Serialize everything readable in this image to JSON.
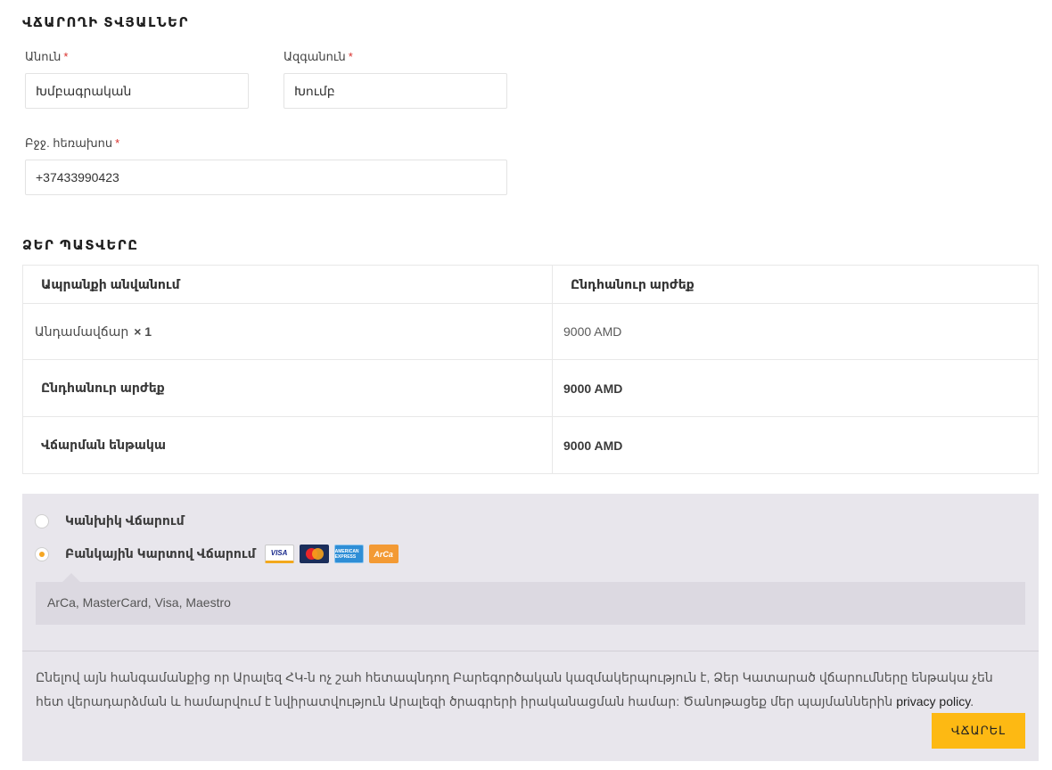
{
  "billing": {
    "title": "ՎՃԱՐՈՂԻ ՏՎՅԱԼՆԵՐ",
    "first_name": {
      "label": "Անուն",
      "required": "*",
      "value": "Խմբագրական"
    },
    "last_name": {
      "label": "Ազգանուն",
      "required": "*",
      "value": "Խումբ"
    },
    "phone": {
      "label": "Բջջ. հեռախոս",
      "required": "*",
      "value": "+37433990423"
    }
  },
  "order": {
    "title": "ՁԵՐ ՊԱՏՎԵՐԸ",
    "columns": [
      "Ապրանքի անվանում",
      "Ընդհանուր արժեք"
    ],
    "items": [
      {
        "name": "Անդամավճար",
        "qty": "× 1",
        "total": "9000 AMD"
      }
    ],
    "subtotal": {
      "label": "Ընդհանուր արժեք",
      "value": "9000 AMD"
    },
    "payable": {
      "label": "Վճարման ենթակա",
      "value": "9000 AMD"
    }
  },
  "payment": {
    "options": [
      {
        "label": "Կանխիկ Վճարում",
        "selected": false
      },
      {
        "label": "Բանկային Կարտով Վճարում",
        "selected": true
      }
    ],
    "cards": {
      "visa": "VISA",
      "mastercard": "",
      "amex": "AMERICAN EXPRESS",
      "arca": "ArCa"
    },
    "description": "ArCa, MasterCard, Visa, Maestro",
    "privacy_text": "Ընելով այն հանգամանքից որ Արալեզ ՀԿ-ն ոչ շահ հետապնդող Բարեգործական կազմակերպություն է, Ձեր Կատարած վճարումները ենթակա չեն հետ վերադարձման և համարվում է նվիրատվություն Արալեզի ծրագրերի իրականացման համար: Ծանոթացեք մեր պայմաններին",
    "privacy_link": "privacy policy",
    "privacy_end": ".",
    "submit_label": "ՎՃԱՐԵԼ"
  },
  "colors": {
    "accent": "#fdb913",
    "radio_selected": "#f5a623",
    "payment_bg": "#e8e6ec",
    "required": "#d9302c"
  }
}
